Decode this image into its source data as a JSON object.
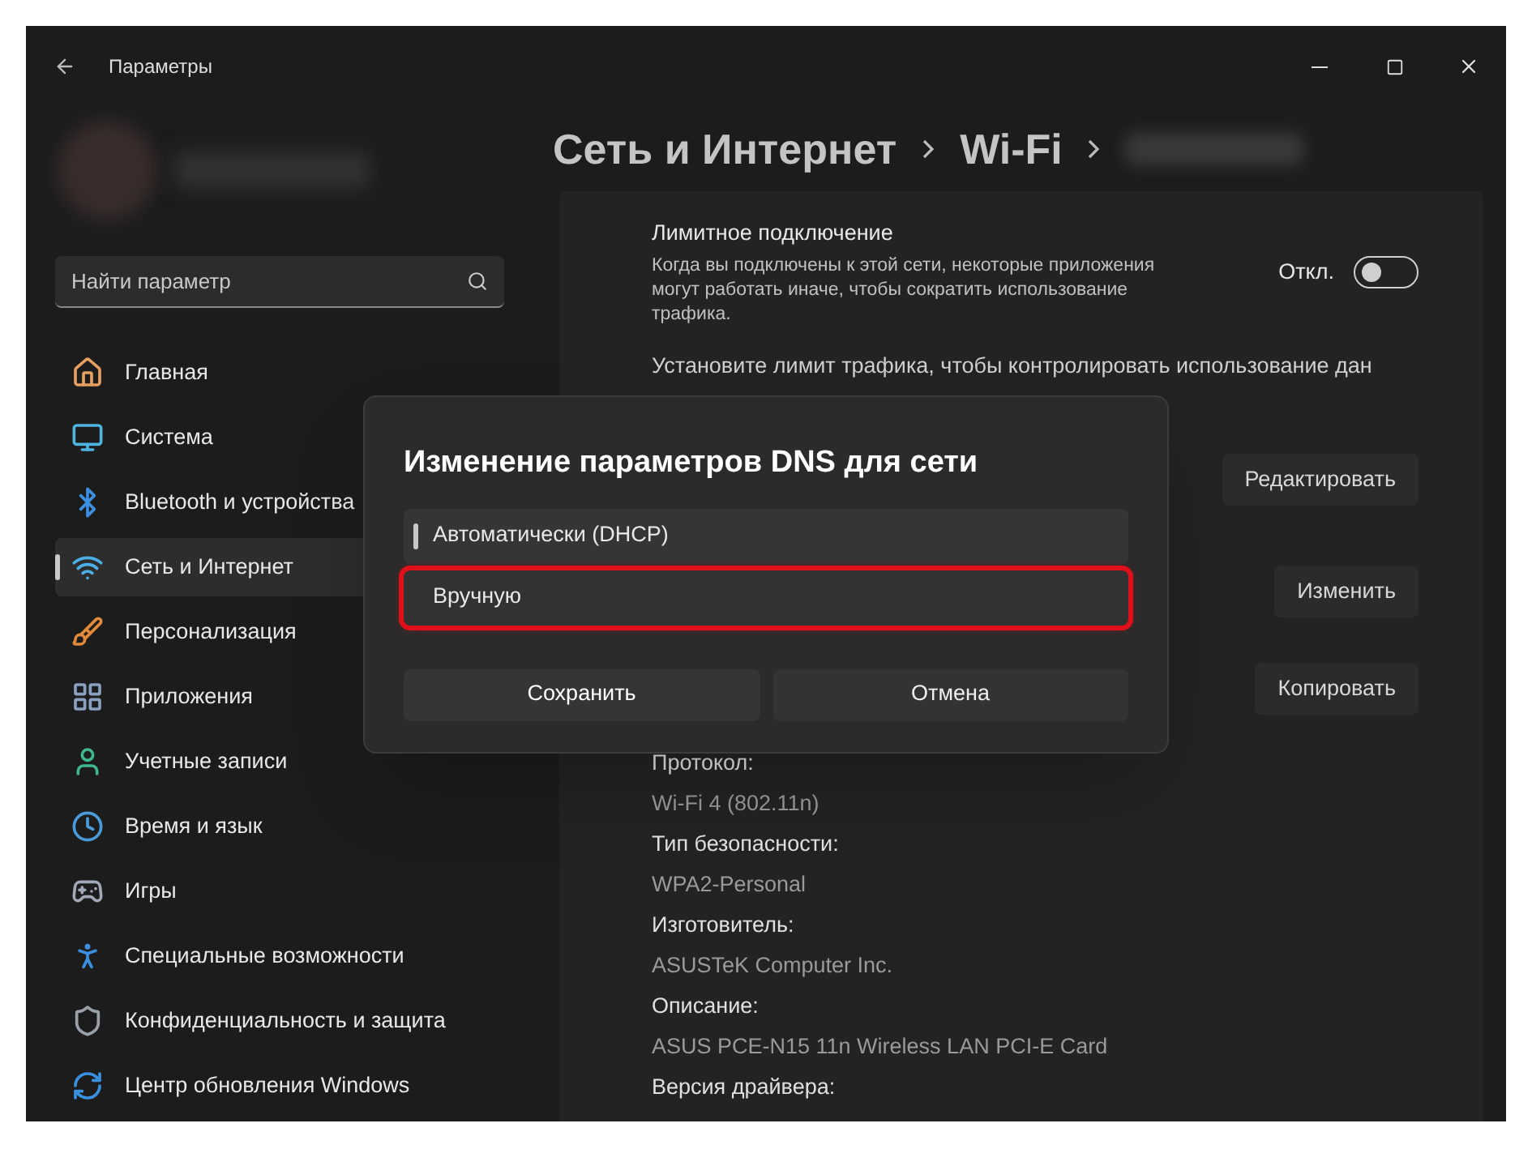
{
  "window": {
    "title": "Параметры"
  },
  "sidebar": {
    "search": {
      "placeholder": "Найти параметр"
    },
    "items": [
      {
        "label": "Главная",
        "selected": false
      },
      {
        "label": "Система",
        "selected": false
      },
      {
        "label": "Bluetooth и устройства",
        "selected": false
      },
      {
        "label": "Сеть и Интернет",
        "selected": true
      },
      {
        "label": "Персонализация",
        "selected": false
      },
      {
        "label": "Приложения",
        "selected": false
      },
      {
        "label": "Учетные записи",
        "selected": false
      },
      {
        "label": "Время и язык",
        "selected": false
      },
      {
        "label": "Игры",
        "selected": false
      },
      {
        "label": "Специальные возможности",
        "selected": false
      },
      {
        "label": "Конфиденциальность и защита",
        "selected": false
      },
      {
        "label": "Центр обновления Windows",
        "selected": false
      }
    ]
  },
  "breadcrumb": [
    "Сеть и Интернет",
    "Wi-Fi"
  ],
  "metered": {
    "title": "Лимитное подключение",
    "description": "Когда вы подключены к этой сети, некоторые приложения могут работать иначе, чтобы сократить использование трафика.",
    "state_label": "Откл.",
    "on": false
  },
  "data_limit_text": "Установите лимит трафика, чтобы контролировать использование дан",
  "row_buttons": [
    "Редактировать",
    "Изменить",
    "Копировать"
  ],
  "properties": [
    {
      "label": "Протокол:",
      "value": "Wi-Fi 4 (802.11n)"
    },
    {
      "label": "Тип безопасности:",
      "value": "WPA2-Personal"
    },
    {
      "label": "Изготовитель:",
      "value": "ASUSTeK Computer Inc."
    },
    {
      "label": "Описание:",
      "value": "ASUS PCE-N15 11n Wireless LAN PCI-E Card"
    },
    {
      "label": "Версия драйвера:"
    }
  ],
  "dialog": {
    "title": "Изменение параметров DNS для сети",
    "options": [
      {
        "label": "Автоматически (DHCP)",
        "selected": true,
        "highlighted": false
      },
      {
        "label": "Вручную",
        "selected": false,
        "highlighted": true
      }
    ],
    "buttons": [
      {
        "label": "Сохранить",
        "kind": "primary"
      },
      {
        "label": "Отмена",
        "kind": "secondary"
      }
    ]
  }
}
